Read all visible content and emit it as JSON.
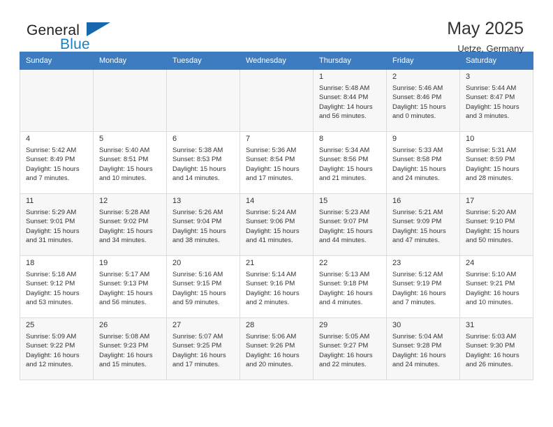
{
  "brand": {
    "word1": "General",
    "word2": "Blue",
    "mark": "triangle-logo"
  },
  "header": {
    "title": "May 2025",
    "subtitle": "Uetze, Germany"
  },
  "colors": {
    "header_blue": "#3d7cc0",
    "brand_blue": "#1a7fc1",
    "shaded_row": "#f7f7f7",
    "grid_border": "#dcdcdc"
  },
  "weekdays": [
    "Sunday",
    "Monday",
    "Tuesday",
    "Wednesday",
    "Thursday",
    "Friday",
    "Saturday"
  ],
  "weeks": [
    [
      {
        "day": "",
        "sunrise": "",
        "sunset": "",
        "daylight1": "",
        "daylight2": "",
        "empty": true
      },
      {
        "day": "",
        "sunrise": "",
        "sunset": "",
        "daylight1": "",
        "daylight2": "",
        "empty": true
      },
      {
        "day": "",
        "sunrise": "",
        "sunset": "",
        "daylight1": "",
        "daylight2": "",
        "empty": true
      },
      {
        "day": "",
        "sunrise": "",
        "sunset": "",
        "daylight1": "",
        "daylight2": "",
        "empty": true
      },
      {
        "day": "1",
        "sunrise": "Sunrise: 5:48 AM",
        "sunset": "Sunset: 8:44 PM",
        "daylight1": "Daylight: 14 hours",
        "daylight2": "and 56 minutes."
      },
      {
        "day": "2",
        "sunrise": "Sunrise: 5:46 AM",
        "sunset": "Sunset: 8:46 PM",
        "daylight1": "Daylight: 15 hours",
        "daylight2": "and 0 minutes."
      },
      {
        "day": "3",
        "sunrise": "Sunrise: 5:44 AM",
        "sunset": "Sunset: 8:47 PM",
        "daylight1": "Daylight: 15 hours",
        "daylight2": "and 3 minutes."
      }
    ],
    [
      {
        "day": "4",
        "sunrise": "Sunrise: 5:42 AM",
        "sunset": "Sunset: 8:49 PM",
        "daylight1": "Daylight: 15 hours",
        "daylight2": "and 7 minutes."
      },
      {
        "day": "5",
        "sunrise": "Sunrise: 5:40 AM",
        "sunset": "Sunset: 8:51 PM",
        "daylight1": "Daylight: 15 hours",
        "daylight2": "and 10 minutes."
      },
      {
        "day": "6",
        "sunrise": "Sunrise: 5:38 AM",
        "sunset": "Sunset: 8:53 PM",
        "daylight1": "Daylight: 15 hours",
        "daylight2": "and 14 minutes."
      },
      {
        "day": "7",
        "sunrise": "Sunrise: 5:36 AM",
        "sunset": "Sunset: 8:54 PM",
        "daylight1": "Daylight: 15 hours",
        "daylight2": "and 17 minutes."
      },
      {
        "day": "8",
        "sunrise": "Sunrise: 5:34 AM",
        "sunset": "Sunset: 8:56 PM",
        "daylight1": "Daylight: 15 hours",
        "daylight2": "and 21 minutes."
      },
      {
        "day": "9",
        "sunrise": "Sunrise: 5:33 AM",
        "sunset": "Sunset: 8:58 PM",
        "daylight1": "Daylight: 15 hours",
        "daylight2": "and 24 minutes."
      },
      {
        "day": "10",
        "sunrise": "Sunrise: 5:31 AM",
        "sunset": "Sunset: 8:59 PM",
        "daylight1": "Daylight: 15 hours",
        "daylight2": "and 28 minutes."
      }
    ],
    [
      {
        "day": "11",
        "sunrise": "Sunrise: 5:29 AM",
        "sunset": "Sunset: 9:01 PM",
        "daylight1": "Daylight: 15 hours",
        "daylight2": "and 31 minutes."
      },
      {
        "day": "12",
        "sunrise": "Sunrise: 5:28 AM",
        "sunset": "Sunset: 9:02 PM",
        "daylight1": "Daylight: 15 hours",
        "daylight2": "and 34 minutes."
      },
      {
        "day": "13",
        "sunrise": "Sunrise: 5:26 AM",
        "sunset": "Sunset: 9:04 PM",
        "daylight1": "Daylight: 15 hours",
        "daylight2": "and 38 minutes."
      },
      {
        "day": "14",
        "sunrise": "Sunrise: 5:24 AM",
        "sunset": "Sunset: 9:06 PM",
        "daylight1": "Daylight: 15 hours",
        "daylight2": "and 41 minutes."
      },
      {
        "day": "15",
        "sunrise": "Sunrise: 5:23 AM",
        "sunset": "Sunset: 9:07 PM",
        "daylight1": "Daylight: 15 hours",
        "daylight2": "and 44 minutes."
      },
      {
        "day": "16",
        "sunrise": "Sunrise: 5:21 AM",
        "sunset": "Sunset: 9:09 PM",
        "daylight1": "Daylight: 15 hours",
        "daylight2": "and 47 minutes."
      },
      {
        "day": "17",
        "sunrise": "Sunrise: 5:20 AM",
        "sunset": "Sunset: 9:10 PM",
        "daylight1": "Daylight: 15 hours",
        "daylight2": "and 50 minutes."
      }
    ],
    [
      {
        "day": "18",
        "sunrise": "Sunrise: 5:18 AM",
        "sunset": "Sunset: 9:12 PM",
        "daylight1": "Daylight: 15 hours",
        "daylight2": "and 53 minutes."
      },
      {
        "day": "19",
        "sunrise": "Sunrise: 5:17 AM",
        "sunset": "Sunset: 9:13 PM",
        "daylight1": "Daylight: 15 hours",
        "daylight2": "and 56 minutes."
      },
      {
        "day": "20",
        "sunrise": "Sunrise: 5:16 AM",
        "sunset": "Sunset: 9:15 PM",
        "daylight1": "Daylight: 15 hours",
        "daylight2": "and 59 minutes."
      },
      {
        "day": "21",
        "sunrise": "Sunrise: 5:14 AM",
        "sunset": "Sunset: 9:16 PM",
        "daylight1": "Daylight: 16 hours",
        "daylight2": "and 2 minutes."
      },
      {
        "day": "22",
        "sunrise": "Sunrise: 5:13 AM",
        "sunset": "Sunset: 9:18 PM",
        "daylight1": "Daylight: 16 hours",
        "daylight2": "and 4 minutes."
      },
      {
        "day": "23",
        "sunrise": "Sunrise: 5:12 AM",
        "sunset": "Sunset: 9:19 PM",
        "daylight1": "Daylight: 16 hours",
        "daylight2": "and 7 minutes."
      },
      {
        "day": "24",
        "sunrise": "Sunrise: 5:10 AM",
        "sunset": "Sunset: 9:21 PM",
        "daylight1": "Daylight: 16 hours",
        "daylight2": "and 10 minutes."
      }
    ],
    [
      {
        "day": "25",
        "sunrise": "Sunrise: 5:09 AM",
        "sunset": "Sunset: 9:22 PM",
        "daylight1": "Daylight: 16 hours",
        "daylight2": "and 12 minutes."
      },
      {
        "day": "26",
        "sunrise": "Sunrise: 5:08 AM",
        "sunset": "Sunset: 9:23 PM",
        "daylight1": "Daylight: 16 hours",
        "daylight2": "and 15 minutes."
      },
      {
        "day": "27",
        "sunrise": "Sunrise: 5:07 AM",
        "sunset": "Sunset: 9:25 PM",
        "daylight1": "Daylight: 16 hours",
        "daylight2": "and 17 minutes."
      },
      {
        "day": "28",
        "sunrise": "Sunrise: 5:06 AM",
        "sunset": "Sunset: 9:26 PM",
        "daylight1": "Daylight: 16 hours",
        "daylight2": "and 20 minutes."
      },
      {
        "day": "29",
        "sunrise": "Sunrise: 5:05 AM",
        "sunset": "Sunset: 9:27 PM",
        "daylight1": "Daylight: 16 hours",
        "daylight2": "and 22 minutes."
      },
      {
        "day": "30",
        "sunrise": "Sunrise: 5:04 AM",
        "sunset": "Sunset: 9:28 PM",
        "daylight1": "Daylight: 16 hours",
        "daylight2": "and 24 minutes."
      },
      {
        "day": "31",
        "sunrise": "Sunrise: 5:03 AM",
        "sunset": "Sunset: 9:30 PM",
        "daylight1": "Daylight: 16 hours",
        "daylight2": "and 26 minutes."
      }
    ]
  ]
}
